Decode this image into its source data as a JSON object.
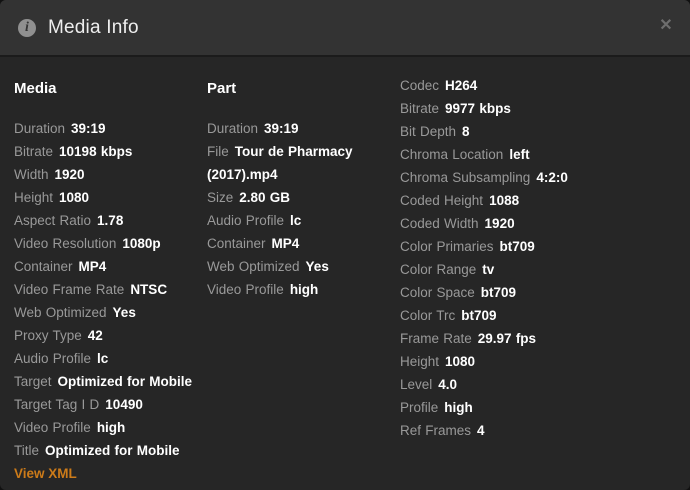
{
  "window": {
    "title": "Media Info",
    "close_icon": "✕",
    "info_icon_glyph": "i"
  },
  "footer": {
    "view_xml_label": "View XML"
  },
  "colors": {
    "header_bg": "#333333",
    "body_bg": "#262626",
    "label_text": "#999999",
    "value_text": "#ffffff",
    "accent_link": "#cc7b19"
  },
  "sections": [
    {
      "title": "Media",
      "rows": [
        {
          "label": "Duration",
          "value": "39:19"
        },
        {
          "label": "Bitrate",
          "value": "10198 kbps"
        },
        {
          "label": "Width",
          "value": "1920"
        },
        {
          "label": "Height",
          "value": "1080"
        },
        {
          "label": "Aspect Ratio",
          "value": "1.78"
        },
        {
          "label": "Video Resolution",
          "value": "1080p"
        },
        {
          "label": "Container",
          "value": "MP4"
        },
        {
          "label": "Video Frame Rate",
          "value": "NTSC"
        },
        {
          "label": "Web Optimized",
          "value": "Yes"
        },
        {
          "label": "Proxy Type",
          "value": "42"
        },
        {
          "label": "Audio Profile",
          "value": "lc"
        },
        {
          "label": "Target",
          "value": "Optimized for Mobile"
        },
        {
          "label": "Target Tag I D",
          "value": "10490"
        },
        {
          "label": "Video Profile",
          "value": "high"
        },
        {
          "label": "Title",
          "value": "Optimized for Mobile"
        }
      ]
    },
    {
      "title": "Part",
      "rows": [
        {
          "label": "Duration",
          "value": "39:19"
        },
        {
          "label": "File",
          "value": "Tour de Pharmacy (2017).mp4"
        },
        {
          "label": "Size",
          "value": "2.80 GB"
        },
        {
          "label": "Audio Profile",
          "value": "lc"
        },
        {
          "label": "Container",
          "value": "MP4"
        },
        {
          "label": "Web Optimized",
          "value": "Yes"
        },
        {
          "label": "Video Profile",
          "value": "high"
        }
      ]
    },
    {
      "title": "",
      "rows": [
        {
          "label": "Codec",
          "value": "H264"
        },
        {
          "label": "Bitrate",
          "value": "9977 kbps"
        },
        {
          "label": "Bit Depth",
          "value": "8"
        },
        {
          "label": "Chroma Location",
          "value": "left"
        },
        {
          "label": "Chroma Subsampling",
          "value": "4:2:0"
        },
        {
          "label": "Coded Height",
          "value": "1088"
        },
        {
          "label": "Coded Width",
          "value": "1920"
        },
        {
          "label": "Color Primaries",
          "value": "bt709"
        },
        {
          "label": "Color Range",
          "value": "tv"
        },
        {
          "label": "Color Space",
          "value": "bt709"
        },
        {
          "label": "Color Trc",
          "value": "bt709"
        },
        {
          "label": "Frame Rate",
          "value": "29.97 fps"
        },
        {
          "label": "Height",
          "value": "1080"
        },
        {
          "label": "Level",
          "value": "4.0"
        },
        {
          "label": "Profile",
          "value": "high"
        },
        {
          "label": "Ref Frames",
          "value": "4"
        }
      ]
    }
  ]
}
